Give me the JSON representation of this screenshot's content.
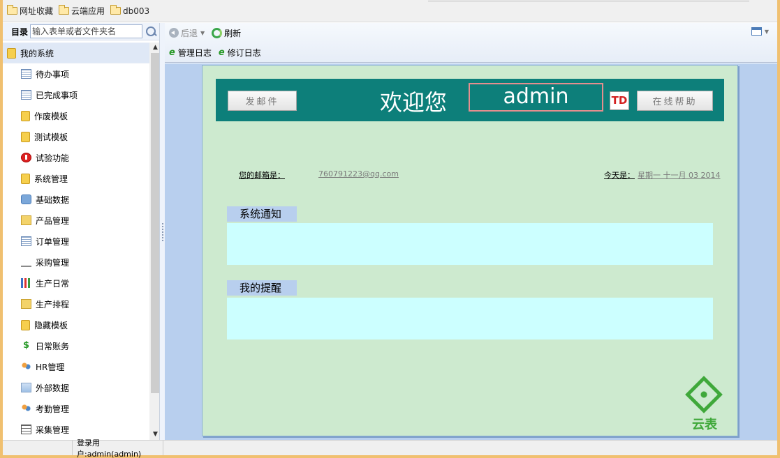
{
  "bookmarks": [
    "网址收藏",
    "云端应用",
    "db003"
  ],
  "sidebar": {
    "title": "目录",
    "search_placeholder": "输入表单或者文件夹名",
    "root": "我的系统",
    "items": [
      {
        "label": "待办事项",
        "icon": "table-icon"
      },
      {
        "label": "已完成事项",
        "icon": "table-icon"
      },
      {
        "label": "作废模板",
        "icon": "folder-icon"
      },
      {
        "label": "测试模板",
        "icon": "folder-icon"
      },
      {
        "label": "试验功能",
        "icon": "power-icon"
      },
      {
        "label": "系统管理",
        "icon": "folder-icon"
      },
      {
        "label": "基础数据",
        "icon": "gear-icon"
      },
      {
        "label": "产品管理",
        "icon": "box-icon"
      },
      {
        "label": "订单管理",
        "icon": "table-icon"
      },
      {
        "label": "采购管理",
        "icon": "cart-icon"
      },
      {
        "label": "生产日常",
        "icon": "bar-chart-icon"
      },
      {
        "label": "生产排程",
        "icon": "box-icon"
      },
      {
        "label": "隐藏模板",
        "icon": "folder-icon"
      },
      {
        "label": "日常账务",
        "icon": "dollar-icon"
      },
      {
        "label": "HR管理",
        "icon": "people-icon"
      },
      {
        "label": "外部数据",
        "icon": "picture-icon"
      },
      {
        "label": "考勤管理",
        "icon": "people-icon"
      },
      {
        "label": "采集管理",
        "icon": "document-icon"
      }
    ]
  },
  "toolbar": {
    "back": "后退",
    "refresh": "刷新",
    "admin_log": "管理日志",
    "revision_log": "修订日志"
  },
  "panel": {
    "send_mail": "发邮件",
    "welcome": "欢迎您",
    "username": "admin",
    "td_logo": "TD",
    "help": "在线帮助",
    "email_label": "您的邮箱是：",
    "email_value": "760791223@qq.com",
    "today_label": "今天是：",
    "today_value": "星期一 十一月 03 2014",
    "notice_title": "系统通知",
    "reminder_title": "我的提醒",
    "logo_text": "云表"
  },
  "status": {
    "login_user": "登录用户:admin(admin)"
  },
  "colors": {
    "banner": "#0d7f7a",
    "panel_bg": "#cdeacf",
    "section_body": "#ccffff",
    "section_title": "#b8cfee",
    "content_bg": "#b8cfee",
    "logo_green": "#3fa83a"
  }
}
